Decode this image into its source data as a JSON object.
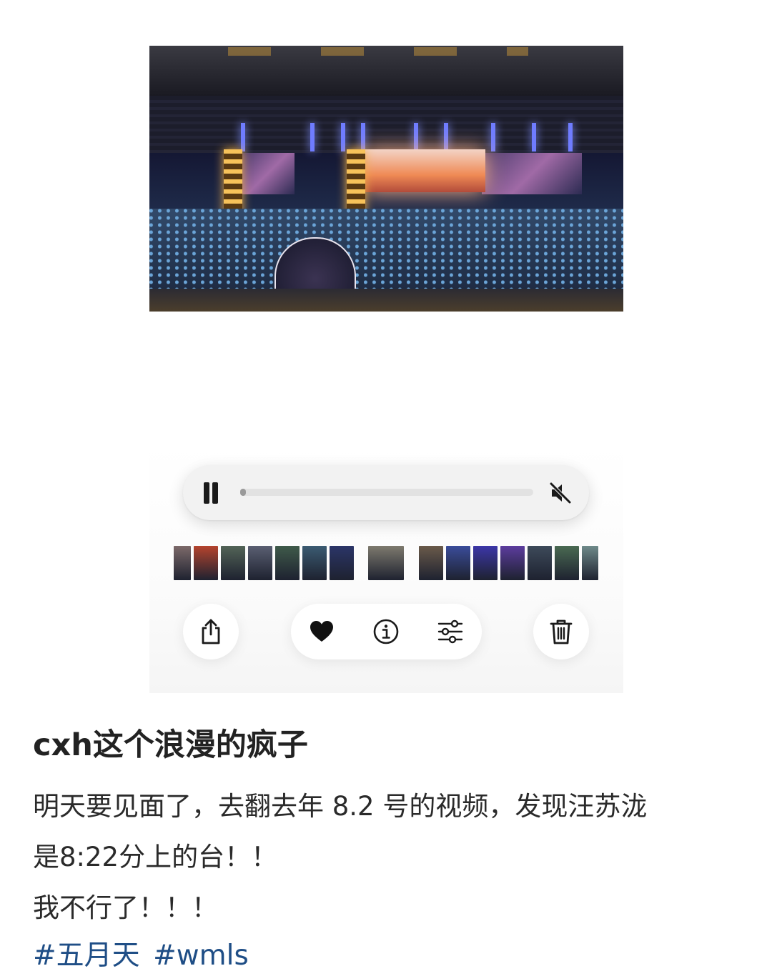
{
  "video": {
    "description_icon": "concert-video-frame"
  },
  "player": {
    "progress": 0.01,
    "pause_icon": "pause-icon",
    "mute_icon": "speaker-muted-icon"
  },
  "thumbnails": [
    {
      "color": "#7d6a6a"
    },
    {
      "color": "#b5442e"
    },
    {
      "color": "#536457"
    },
    {
      "color": "#5a5f72"
    },
    {
      "color": "#3f5a4a"
    },
    {
      "color": "#3b5b72"
    },
    {
      "color": "#2b3568"
    },
    {
      "color": "#7e7a6e"
    },
    {
      "color": "#6a5a4a"
    },
    {
      "color": "#3a4c9a"
    },
    {
      "color": "#3c36a8"
    },
    {
      "color": "#5c3c9e"
    },
    {
      "color": "#3d4a5a"
    },
    {
      "color": "#4a6a52"
    },
    {
      "color": "#6f8a8a"
    }
  ],
  "actions": {
    "share_icon": "share-icon",
    "like_icon": "heart-icon",
    "info_icon": "info-icon",
    "adjust_icon": "sliders-icon",
    "delete_icon": "trash-icon"
  },
  "post": {
    "title": "cxh这个浪漫的疯子",
    "lines": [
      "明天要见面了，去翻去年 8.2 号的视频，发现汪苏泷",
      "是8:22分上的台！！",
      "我不行了！！！"
    ],
    "tags": [
      "#五月天",
      "#wmls"
    ],
    "tag_color": "#1f4e86"
  }
}
